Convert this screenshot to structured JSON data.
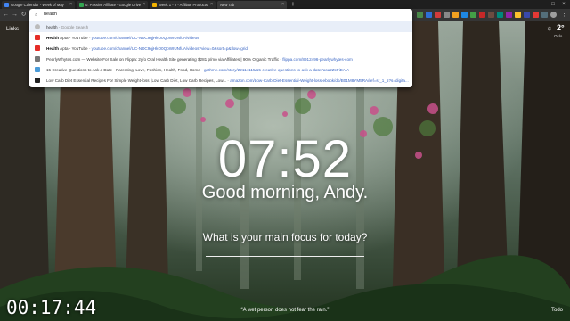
{
  "tabs": [
    {
      "title": "Google Calendar - Week of May",
      "color": "#4285f4",
      "active": false
    },
    {
      "title": "0. Passive Affiliate - Google Drive",
      "color": "#34a853",
      "active": false
    },
    {
      "title": "Week 1 - 2 - Affiliate Products",
      "color": "#f4b400",
      "active": false
    },
    {
      "title": "New Tab",
      "color": "#888888",
      "active": true
    }
  ],
  "omnibox": {
    "input": "health",
    "suggestions": [
      {
        "bold": "",
        "text": "health",
        "sep": " - ",
        "url": "Google Search",
        "icon": "google-search-icon",
        "color": "#999999"
      },
      {
        "bold": "Health",
        "text": " Apta - YouTube",
        "sep": " - ",
        "url": "youtube.com/channel/UC-NDC9qjHkO0QpWIUNfuA/videos",
        "icon": "youtube-icon",
        "color": "#e52d27"
      },
      {
        "bold": "Health",
        "text": " Apta - YouTube",
        "sep": " - ",
        "url": "youtube.com/channel/UC-NDC9qjHkO0QpWIUNfuA/videos?view=0&sort=p&flow=grid",
        "icon": "youtube-icon",
        "color": "#e52d27"
      },
      {
        "bold": "",
        "text": "PearlyWhytes.com — Website For Sale on Flippa: 2y/o Oral Health Site generating $281 p/mo via Affiliates | 90% Organic Traffic",
        "sep": " - ",
        "url": "flippa.com/8912496-pearlywhytes-com",
        "icon": "flippa-icon",
        "color": "#777777"
      },
      {
        "bold": "",
        "text": "15 Creative Questions to Ask a Date - Parenting, Love, Fashion, Health, Food, Home",
        "sep": " - ",
        "url": "gathme.com/story/22114115/15-creative-questions-to-ask-a-date#asa2ZcFiEAIA",
        "icon": "gathme-icon",
        "color": "#4a9bd8"
      },
      {
        "bold": "",
        "text": "Low Carb Diet Essential Recipes For Simple Weight-loss (Low Carb Diet, Low Carb Recipes, Low...",
        "sep": " - ",
        "url": "amazon.com/Low-Carb-Diet-Essential-Weight-loss-ebook/dp/B01M8YM5RA/ref=sr_1_5?s=digita...",
        "icon": "amazon-icon",
        "color": "#222222"
      }
    ]
  },
  "widgets": {
    "links": "Links",
    "temperature": "2°",
    "city": "Oslo",
    "time": "07:52",
    "greeting": "Good morning, Andy.",
    "focus_question": "What is your main focus for today?",
    "quote": "“A wet person does not fear the rain.”",
    "todo": "Todo"
  },
  "overlay_timer": "00:17:44",
  "colors": {
    "accent": "#3a66c4",
    "chrome_dark": "#1f1f1f",
    "chrome_toolbar": "#353535"
  }
}
